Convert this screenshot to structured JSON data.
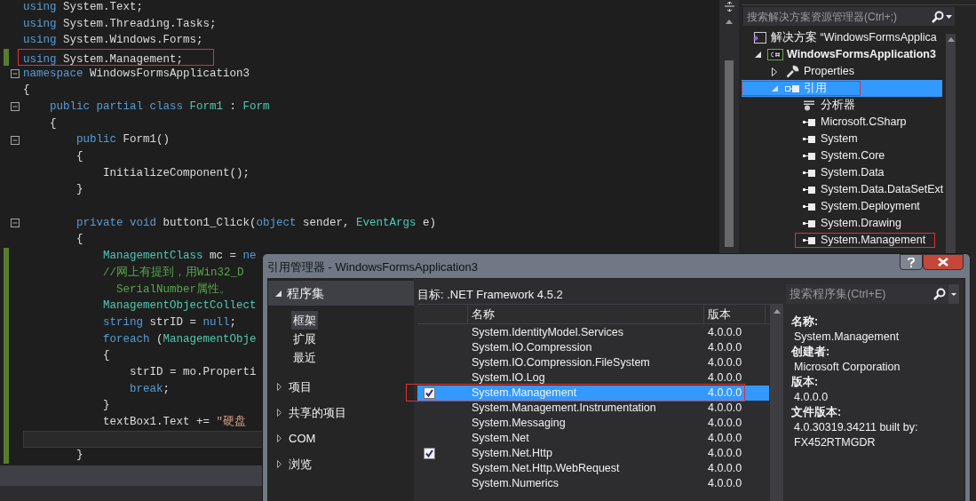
{
  "editor": {
    "lines": [
      {
        "kind": "code",
        "foldable": false,
        "changed": false,
        "current": false,
        "annotated": false,
        "tokens": [
          {
            "kind": "keyword",
            "text": "using"
          },
          {
            "kind": "plain",
            "text": " System.Text;"
          }
        ]
      },
      {
        "kind": "code",
        "foldable": false,
        "changed": false,
        "current": false,
        "annotated": false,
        "tokens": [
          {
            "kind": "keyword",
            "text": "using"
          },
          {
            "kind": "plain",
            "text": " System.Threading.Tasks;"
          }
        ]
      },
      {
        "kind": "code",
        "foldable": false,
        "changed": false,
        "current": false,
        "annotated": false,
        "tokens": [
          {
            "kind": "keyword",
            "text": "using"
          },
          {
            "kind": "plain",
            "text": " System.Windows.Forms;"
          }
        ]
      },
      {
        "kind": "code",
        "foldable": false,
        "changed": true,
        "current": false,
        "annotated": true,
        "tokens": [
          {
            "kind": "keyword",
            "text": "using"
          },
          {
            "kind": "plain",
            "text": " System.Management;"
          }
        ]
      },
      {
        "kind": "code",
        "foldable": true,
        "changed": false,
        "current": false,
        "annotated": false,
        "tokens": [
          {
            "kind": "keyword",
            "text": "namespace"
          },
          {
            "kind": "plain",
            "text": " WindowsFormsApplication3"
          }
        ]
      },
      {
        "kind": "code",
        "foldable": false,
        "changed": false,
        "current": false,
        "annotated": false,
        "tokens": [
          {
            "kind": "plain",
            "text": "{"
          }
        ]
      },
      {
        "kind": "code",
        "foldable": true,
        "changed": false,
        "current": false,
        "annotated": false,
        "tokens": [
          {
            "kind": "keyword",
            "text": "    public partial class "
          },
          {
            "kind": "type",
            "text": "Form1"
          },
          {
            "kind": "plain",
            "text": " : "
          },
          {
            "kind": "type",
            "text": "Form"
          }
        ]
      },
      {
        "kind": "code",
        "foldable": false,
        "changed": false,
        "current": false,
        "annotated": false,
        "tokens": [
          {
            "kind": "plain",
            "text": "    {"
          }
        ]
      },
      {
        "kind": "code",
        "foldable": true,
        "changed": false,
        "current": false,
        "annotated": false,
        "tokens": [
          {
            "kind": "keyword",
            "text": "        public"
          },
          {
            "kind": "plain",
            "text": " Form1()"
          }
        ]
      },
      {
        "kind": "code",
        "foldable": false,
        "changed": false,
        "current": false,
        "annotated": false,
        "tokens": [
          {
            "kind": "plain",
            "text": "        {"
          }
        ]
      },
      {
        "kind": "code",
        "foldable": false,
        "changed": false,
        "current": false,
        "annotated": false,
        "tokens": [
          {
            "kind": "plain",
            "text": "            InitializeComponent();"
          }
        ]
      },
      {
        "kind": "code",
        "foldable": false,
        "changed": false,
        "current": false,
        "annotated": false,
        "tokens": [
          {
            "kind": "plain",
            "text": "        }"
          }
        ]
      },
      {
        "kind": "blank",
        "foldable": false,
        "changed": false,
        "current": false,
        "annotated": false
      },
      {
        "kind": "code",
        "foldable": true,
        "changed": false,
        "current": false,
        "annotated": false,
        "tokens": [
          {
            "kind": "keyword",
            "text": "        private void"
          },
          {
            "kind": "plain",
            "text": " button1_Click("
          },
          {
            "kind": "keyword",
            "text": "object"
          },
          {
            "kind": "plain",
            "text": " sender, "
          },
          {
            "kind": "type",
            "text": "EventArgs"
          },
          {
            "kind": "plain",
            "text": " e)"
          }
        ]
      },
      {
        "kind": "code",
        "foldable": false,
        "changed": false,
        "current": false,
        "annotated": false,
        "tokens": [
          {
            "kind": "plain",
            "text": "        {"
          }
        ]
      },
      {
        "kind": "code",
        "foldable": false,
        "changed": true,
        "current": false,
        "annotated": false,
        "tokens": [
          {
            "kind": "type",
            "text": "            ManagementClass"
          },
          {
            "kind": "plain",
            "text": " mc = "
          },
          {
            "kind": "keyword",
            "text": "ne"
          }
        ]
      },
      {
        "kind": "code",
        "foldable": false,
        "changed": true,
        "current": false,
        "annotated": false,
        "tokens": [
          {
            "kind": "comment",
            "text": "            //网上有提到，用Win32_D"
          }
        ]
      },
      {
        "kind": "code",
        "foldable": false,
        "changed": true,
        "current": false,
        "annotated": false,
        "tokens": [
          {
            "kind": "comment",
            "text": "              SerialNumber属性。"
          }
        ]
      },
      {
        "kind": "code",
        "foldable": false,
        "changed": true,
        "current": false,
        "annotated": false,
        "tokens": [
          {
            "kind": "type",
            "text": "            ManagementObjectCollect"
          }
        ]
      },
      {
        "kind": "code",
        "foldable": false,
        "changed": true,
        "current": false,
        "annotated": false,
        "tokens": [
          {
            "kind": "keyword",
            "text": "            string"
          },
          {
            "kind": "plain",
            "text": " strID = "
          },
          {
            "kind": "keyword",
            "text": "null"
          },
          {
            "kind": "plain",
            "text": ";"
          }
        ]
      },
      {
        "kind": "code",
        "foldable": false,
        "changed": true,
        "current": false,
        "annotated": false,
        "tokens": [
          {
            "kind": "keyword",
            "text": "            foreach"
          },
          {
            "kind": "plain",
            "text": " ("
          },
          {
            "kind": "type",
            "text": "ManagementObje"
          }
        ]
      },
      {
        "kind": "code",
        "foldable": false,
        "changed": true,
        "current": false,
        "annotated": false,
        "tokens": [
          {
            "kind": "plain",
            "text": "            {"
          }
        ]
      },
      {
        "kind": "code",
        "foldable": false,
        "changed": true,
        "current": false,
        "annotated": false,
        "tokens": [
          {
            "kind": "plain",
            "text": "                strID = mo.Properti"
          }
        ]
      },
      {
        "kind": "code",
        "foldable": false,
        "changed": true,
        "current": false,
        "annotated": false,
        "tokens": [
          {
            "kind": "keyword",
            "text": "                break"
          },
          {
            "kind": "plain",
            "text": ";"
          }
        ]
      },
      {
        "kind": "code",
        "foldable": false,
        "changed": true,
        "current": false,
        "annotated": false,
        "tokens": [
          {
            "kind": "plain",
            "text": "            }"
          }
        ]
      },
      {
        "kind": "code",
        "foldable": false,
        "changed": true,
        "current": false,
        "annotated": false,
        "tokens": [
          {
            "kind": "plain",
            "text": "            textBox1.Text += "
          },
          {
            "kind": "string",
            "text": "\"硬盘"
          }
        ]
      },
      {
        "kind": "blank",
        "foldable": false,
        "changed": true,
        "current": true,
        "annotated": false
      },
      {
        "kind": "code",
        "foldable": false,
        "changed": true,
        "current": false,
        "annotated": false,
        "tokens": [
          {
            "kind": "plain",
            "text": "        }"
          }
        ]
      }
    ]
  },
  "solution_explorer": {
    "search": {
      "placeholder": "搜索解决方案资源管理器(Ctrl+;)"
    },
    "tree": [
      {
        "kind": "solution",
        "label": "解决方案 “WindowsFormsApplica",
        "selected": false,
        "annotated": false,
        "children": [
          {
            "kind": "project",
            "label": "WindowsFormsApplication3",
            "expanded": true,
            "selected": false,
            "annotated": false,
            "children": [
              {
                "kind": "properties",
                "label": "Properties",
                "expanded": false,
                "selected": false,
                "annotated": false
              },
              {
                "kind": "references",
                "label": "引用",
                "expanded": true,
                "selected": true,
                "annotated": true,
                "children": [
                  {
                    "kind": "analyzer",
                    "label": "分析器",
                    "selected": false,
                    "annotated": false
                  },
                  {
                    "kind": "reference",
                    "label": "Microsoft.CSharp",
                    "selected": false,
                    "annotated": false
                  },
                  {
                    "kind": "reference",
                    "label": "System",
                    "selected": false,
                    "annotated": false
                  },
                  {
                    "kind": "reference",
                    "label": "System.Core",
                    "selected": false,
                    "annotated": false
                  },
                  {
                    "kind": "reference",
                    "label": "System.Data",
                    "selected": false,
                    "annotated": false
                  },
                  {
                    "kind": "reference",
                    "label": "System.Data.DataSetExt",
                    "selected": false,
                    "annotated": false
                  },
                  {
                    "kind": "reference",
                    "label": "System.Deployment",
                    "selected": false,
                    "annotated": false
                  },
                  {
                    "kind": "reference",
                    "label": "System.Drawing",
                    "selected": false,
                    "annotated": false
                  },
                  {
                    "kind": "reference",
                    "label": "System.Management",
                    "selected": false,
                    "annotated": true
                  }
                ]
              }
            ]
          }
        ]
      }
    ]
  },
  "dialog": {
    "title": "引用管理器 - WindowsFormsApplication3",
    "nav": [
      {
        "label": "程序集",
        "expanded": true,
        "children": [
          {
            "label": "框架",
            "selected": true
          },
          {
            "label": "扩展",
            "selected": false
          },
          {
            "label": "最近",
            "selected": false
          }
        ]
      },
      {
        "label": "项目",
        "expanded": false
      },
      {
        "label": "共享的项目",
        "expanded": false
      },
      {
        "label": "COM",
        "expanded": false
      },
      {
        "label": "浏览",
        "expanded": false
      }
    ],
    "target": "目标: .NET Framework 4.5.2",
    "columns": [
      "名称",
      "版本"
    ],
    "rows": [
      {
        "name": "System.IdentityModel.Services",
        "version": "4.0.0.0",
        "checked": false,
        "selected": false,
        "annotated": false
      },
      {
        "name": "System.IO.Compression",
        "version": "4.0.0.0",
        "checked": false,
        "selected": false,
        "annotated": false
      },
      {
        "name": "System.IO.Compression.FileSystem",
        "version": "4.0.0.0",
        "checked": false,
        "selected": false,
        "annotated": false
      },
      {
        "name": "System.IO.Log",
        "version": "4.0.0.0",
        "checked": false,
        "selected": false,
        "annotated": false
      },
      {
        "name": "System.Management",
        "version": "4.0.0.0",
        "checked": true,
        "selected": true,
        "annotated": true
      },
      {
        "name": "System.Management.Instrumentation",
        "version": "4.0.0.0",
        "checked": false,
        "selected": false,
        "annotated": false
      },
      {
        "name": "System.Messaging",
        "version": "4.0.0.0",
        "checked": false,
        "selected": false,
        "annotated": false
      },
      {
        "name": "System.Net",
        "version": "4.0.0.0",
        "checked": false,
        "selected": false,
        "annotated": false
      },
      {
        "name": "System.Net.Http",
        "version": "4.0.0.0",
        "checked": true,
        "selected": false,
        "annotated": false
      },
      {
        "name": "System.Net.Http.WebRequest",
        "version": "4.0.0.0",
        "checked": false,
        "selected": false,
        "annotated": false
      },
      {
        "name": "System.Numerics",
        "version": "4.0.0.0",
        "checked": false,
        "selected": false,
        "annotated": false
      }
    ],
    "search": {
      "placeholder": "搜索程序集(Ctrl+E)"
    },
    "details": [
      {
        "label": "名称:",
        "value": "System.Management"
      },
      {
        "label": "创建者:",
        "value": "Microsoft Corporation"
      },
      {
        "label": "版本:",
        "value": "4.0.0.0"
      },
      {
        "label": "文件版本:",
        "value": "4.0.30319.34211 built by: FX452RTMGDR"
      }
    ]
  }
}
